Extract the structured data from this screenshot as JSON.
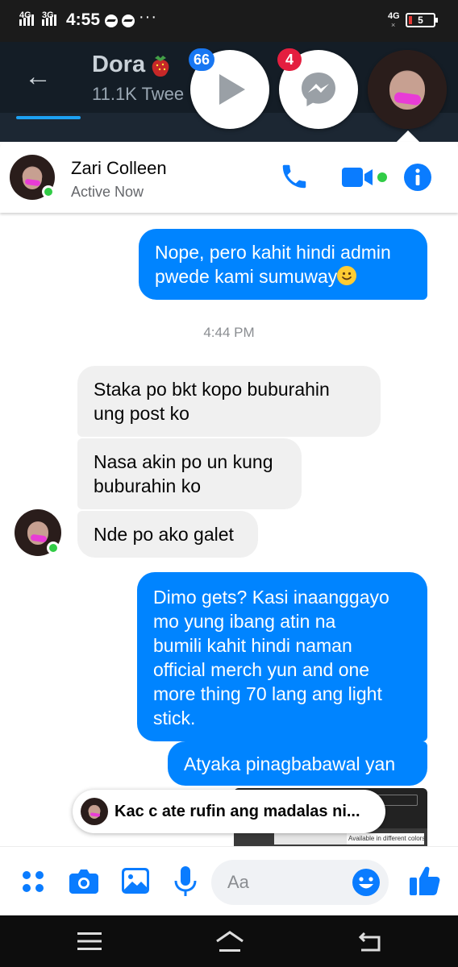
{
  "status_bar": {
    "network1": "4G",
    "network2": "3G",
    "time": "4:55",
    "more": "···",
    "network_right": "4G",
    "battery": "5"
  },
  "background_app": {
    "profile_name": "Dora",
    "tweet_count": "11.1K Twee"
  },
  "chat_heads": [
    {
      "name": "video-head",
      "badge": "66"
    },
    {
      "name": "messenger-head",
      "badge": "4"
    },
    {
      "name": "zari-head",
      "badge": ""
    }
  ],
  "chat_header": {
    "contact_name": "Zari Colleen",
    "status": "Active Now"
  },
  "messages": [
    {
      "from": "me",
      "lines": [
        "Nope, pero kahit hindi admin",
        "pwede kami sumuway"
      ],
      "emoji": "slightly-smiling-face"
    },
    {
      "type": "timestamp",
      "text": "4:44 PM"
    },
    {
      "from": "them",
      "lines": [
        "Staka po bkt kopo buburahin",
        "ung post ko"
      ]
    },
    {
      "from": "them",
      "lines": [
        "Nasa akin po un kung",
        "buburahin ko"
      ]
    },
    {
      "from": "them",
      "lines": [
        "Nde po ako galet"
      ]
    },
    {
      "from": "me",
      "lines": [
        "Dimo gets? Kasi inaanggayo",
        "mo yung ibang atin na",
        "bumili kahit hindi naman",
        "official merch yun and one",
        "more thing 70 lang ang light",
        "stick."
      ]
    },
    {
      "from": "me",
      "lines": [
        "Atyaka pinagbabawal yan"
      ]
    }
  ],
  "reply_preview": {
    "text": "Kac c ate rufin ang madalas ni..."
  },
  "link_preview": {
    "caption": "Available in different colors!"
  },
  "composer": {
    "placeholder": "Aa"
  },
  "colors": {
    "messenger_blue": "#0084ff",
    "icon_blue": "#0a7cff",
    "online_green": "#31cc46",
    "badge_red": "#e41e3f",
    "twitter_bg": "#141d26"
  }
}
